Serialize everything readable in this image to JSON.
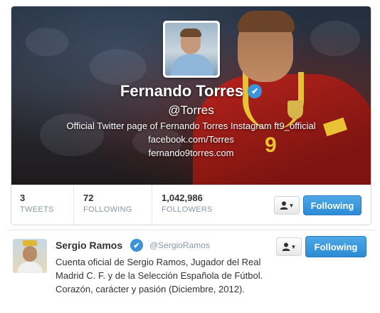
{
  "profile": {
    "name": "Fernando Torres",
    "verified_mark": "✔",
    "handle": "@Torres",
    "bio": "Official Twitter page of Fernando Torres Instagram ft9_official",
    "links": [
      "facebook.com/Torres",
      "fernando9torres.com"
    ],
    "player_number": "9",
    "stats": [
      {
        "value": "3",
        "label": "TWEETS"
      },
      {
        "value": "72",
        "label": "FOLLOWING"
      },
      {
        "value": "1,042,986",
        "label": "FOLLOWERS"
      }
    ],
    "follow_button_label": "Following",
    "user_menu_icon": "user-icon"
  },
  "user_item": {
    "name": "Sergio Ramos",
    "verified_mark": "✔",
    "handle": "@SergioRamos",
    "bio": "Cuenta oficial de Sergio Ramos, Jugador del Real Madrid C. F. y de la Selección Española de Fútbol. Corazón, carácter y pasión (Diciembre, 2012).",
    "follow_button_label": "Following",
    "user_menu_icon": "user-icon"
  },
  "colors": {
    "accent_blue": "#2b8bd4",
    "verified_blue": "#3b94d9",
    "muted_text": "#8899a6"
  }
}
